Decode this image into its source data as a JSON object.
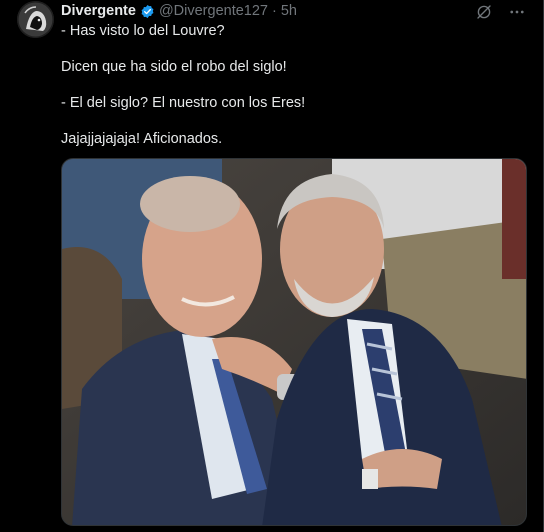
{
  "author": {
    "name": "Divergente",
    "handle": "@Divergente127",
    "separator": "·",
    "time": "5h"
  },
  "icons": {
    "avatar": "avatar-illustration",
    "verified": "verified-badge-icon",
    "grok": "grok-icon",
    "more": "more-icon"
  },
  "colors": {
    "background": "#000000",
    "text": "#e7e9ea",
    "muted": "#71767b",
    "verified": "#1d9bf0",
    "border": "#2f3336"
  },
  "tweet": {
    "lines": [
      "- Has visto lo del Louvre?",
      "",
      "Dicen que ha sido el robo del siglo!",
      "",
      "- El del siglo? El nuestro con los Eres!",
      "",
      "Jajajjajajaja! Aficionados."
    ]
  },
  "media": {
    "description_icon": "photo"
  }
}
